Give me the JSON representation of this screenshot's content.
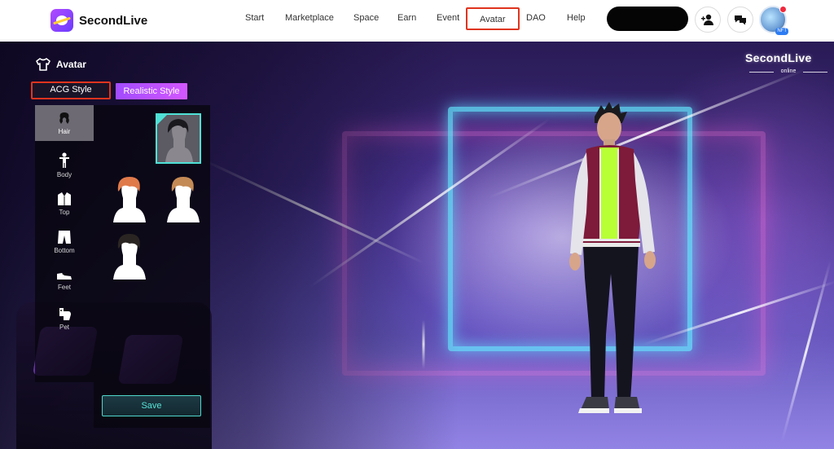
{
  "app": {
    "name": "SecondLive"
  },
  "nav": {
    "items": [
      "Start",
      "Marketplace",
      "Space",
      "Earn",
      "Event",
      "Avatar",
      "DAO",
      "Help"
    ],
    "active": "Avatar",
    "badge": "NFT"
  },
  "scene": {
    "brand": "SecondLive",
    "brand_sub": "online"
  },
  "panel": {
    "title": "Avatar",
    "style_tabs": [
      "ACG Style",
      "Realistic Style"
    ],
    "active_style": "ACG Style",
    "categories": [
      "Hair",
      "Body",
      "Top",
      "Bottom",
      "Feet",
      "Pet"
    ],
    "active_category": "Hair",
    "save_label": "Save"
  },
  "colors": {
    "accent_teal": "#4fe0d6",
    "highlight_red": "#e0341e",
    "realistic_tab": "#b44dff"
  }
}
